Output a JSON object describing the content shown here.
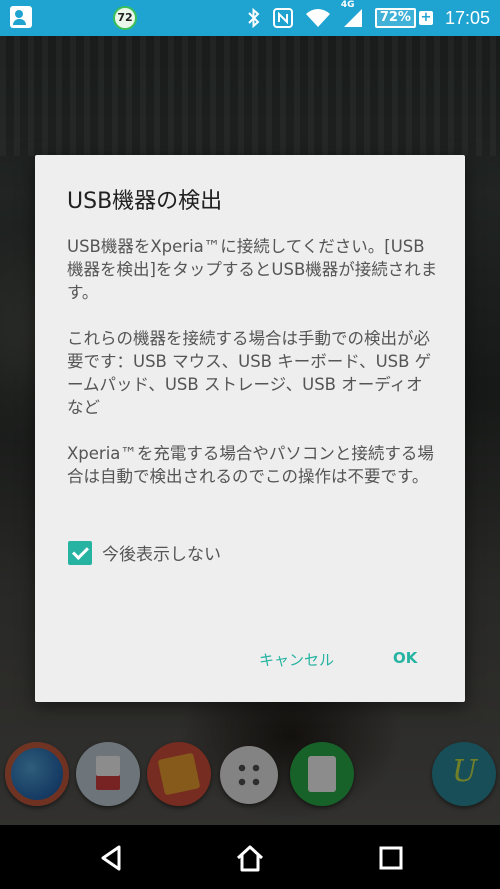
{
  "status_bar": {
    "notification_badge": "72",
    "battery_percent": "72%",
    "battery_charging_symbol": "+",
    "time": "17:05",
    "network_label": "4G",
    "icons": [
      "contact-card-icon",
      "bluetooth-icon",
      "nfc-icon",
      "wifi-icon",
      "cell-signal-icon",
      "battery-icon"
    ]
  },
  "dialog": {
    "title": "USB機器の検出",
    "paragraphs": [
      "USB機器をXperia™に接続してください。[USB機器を検出]をタップするとUSB機器が接続されます。",
      "これらの機器を接続する場合は手動での検出が必要です：USB マウス、USB キーボード、USB ゲームパッド、USB ストレージ、USB オーディオなど",
      "Xperia™を充電する場合やパソコンと接続する場合は自動で検出されるのでこの操作は不要です。"
    ],
    "checkbox_label": "今後表示しない",
    "checkbox_checked": true,
    "cancel_label": "キャンセル",
    "ok_label": "OK"
  },
  "dock": {
    "apps": [
      "globe-browser-icon",
      "contacts-icon",
      "album-icon",
      "app-drawer-icon",
      "feedly-icon",
      "app-icon"
    ]
  },
  "nav": {
    "buttons": [
      "back-icon",
      "home-icon",
      "recent-apps-icon"
    ]
  },
  "colors": {
    "status_bar": "#1fa4d1",
    "accent": "#27b3a2",
    "dialog_bg": "#eeeeee"
  }
}
